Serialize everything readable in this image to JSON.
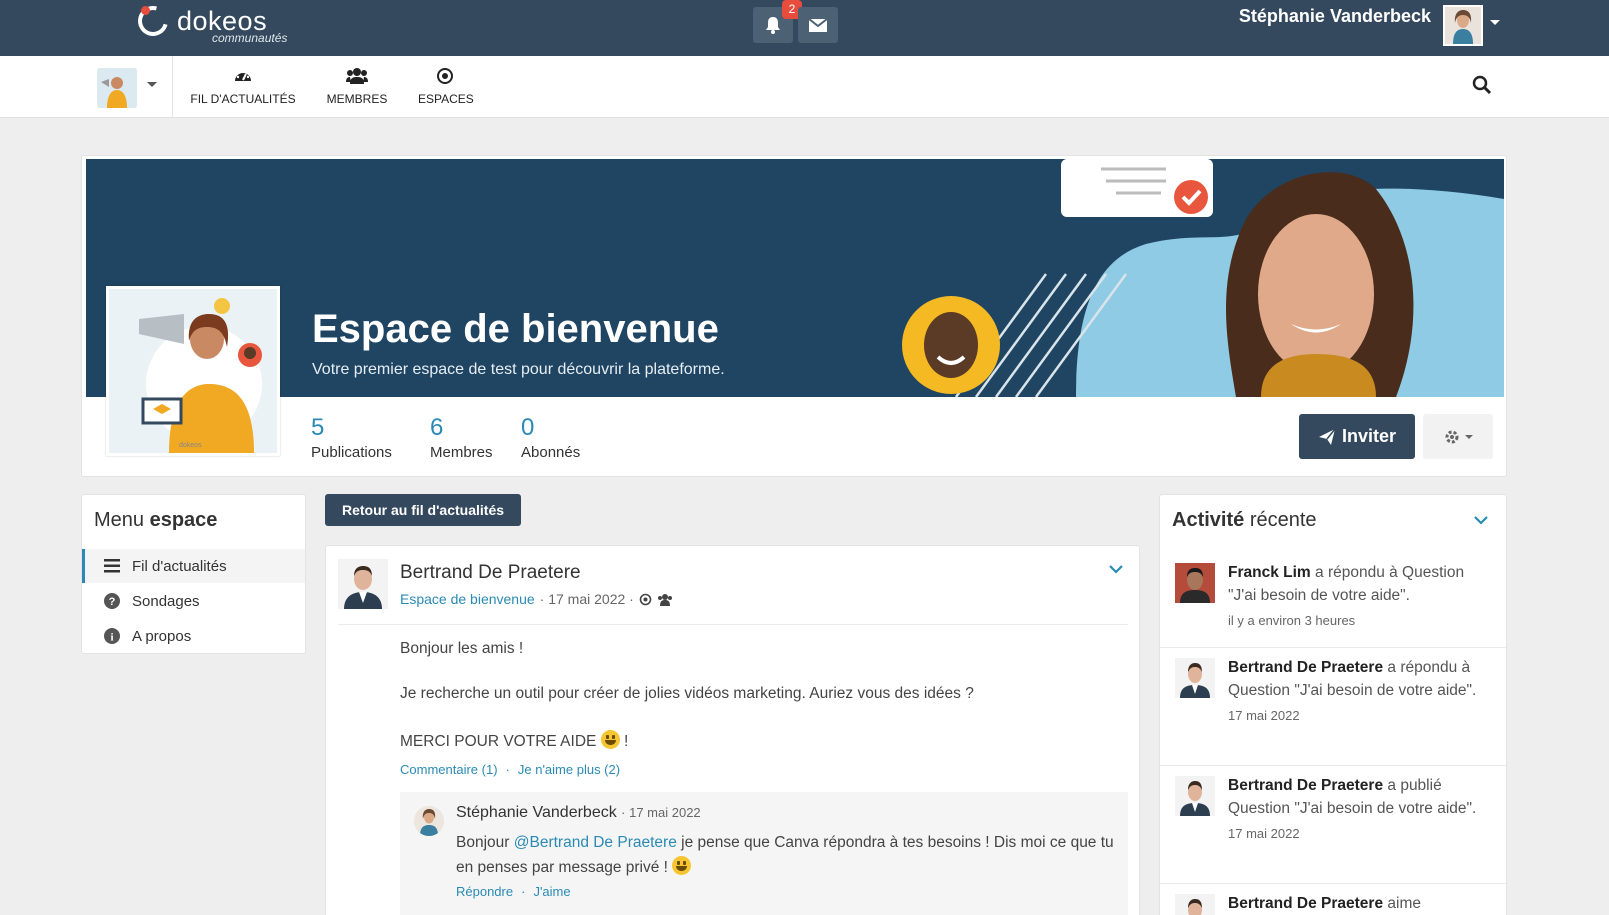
{
  "brand": {
    "name": "dokeos",
    "subtitle": "communautés"
  },
  "topbar": {
    "notifications_count": "2",
    "user_name": "Stéphanie Vanderbeck"
  },
  "nav": {
    "items": [
      {
        "label": "FIL D'ACTUALITÉS",
        "icon": "dashboard-icon"
      },
      {
        "label": "MEMBRES",
        "icon": "users-icon"
      },
      {
        "label": "ESPACES",
        "icon": "target-icon"
      }
    ]
  },
  "space": {
    "title": "Espace de bienvenue",
    "subtitle": "Votre premier espace de test pour découvrir la plateforme.",
    "stats": [
      {
        "value": "5",
        "label": "Publications"
      },
      {
        "value": "6",
        "label": "Membres"
      },
      {
        "value": "0",
        "label": "Abonnés"
      }
    ],
    "invite_label": "Inviter"
  },
  "menu": {
    "title_light": "Menu",
    "title_bold": "espace",
    "items": [
      {
        "label": "Fil d'actualités",
        "icon": "list-icon",
        "active": true
      },
      {
        "label": "Sondages",
        "icon": "question-icon"
      },
      {
        "label": "A propos",
        "icon": "info-icon"
      }
    ]
  },
  "feed": {
    "back_label": "Retour au fil d'actualités",
    "post": {
      "author": "Bertrand De Praetere",
      "space_link": "Espace de bienvenue",
      "date": "· 17 mai 2022 ·",
      "lines": [
        "Bonjour les amis !",
        "Je recherche un outil pour créer de jolies vidéos marketing. Auriez vous des idées ?",
        "MERCI POUR VOTRE AIDE"
      ],
      "line3_suffix": "!",
      "comment_link": "Commentaire (1)",
      "unlike_link": "Je n'aime plus (2)",
      "dot": "·",
      "comment": {
        "author": "Stéphanie Vanderbeck",
        "date": "· 17 mai 2022",
        "text_before": "Bonjour",
        "mention": "@Bertrand De Praetere",
        "text_after": "je pense que Canva répondra à tes besoins ! Dis moi ce que tu en penses par message privé !",
        "reply": "Répondre",
        "like": "J'aime"
      }
    }
  },
  "activity": {
    "title_bold": "Activité",
    "title_light": "récente",
    "items": [
      {
        "name": "Franck Lim",
        "text": "a répondu à Question \"J'ai besoin de votre aide\".",
        "time": "il y a environ 3 heures"
      },
      {
        "name": "Bertrand De Praetere",
        "text": "a répondu à Question \"J'ai besoin de votre aide\".",
        "time": "17 mai 2022"
      },
      {
        "name": "Bertrand De Praetere",
        "text": "a publié Question \"J'ai besoin de votre aide\".",
        "time": "17 mai 2022"
      },
      {
        "name": "Bertrand De Praetere",
        "text": "aime",
        "time": ""
      }
    ]
  },
  "colors": {
    "topbar": "#34495e",
    "accent": "#2a8ab4",
    "badge": "#e74c3c",
    "banner": "#1f4563"
  }
}
